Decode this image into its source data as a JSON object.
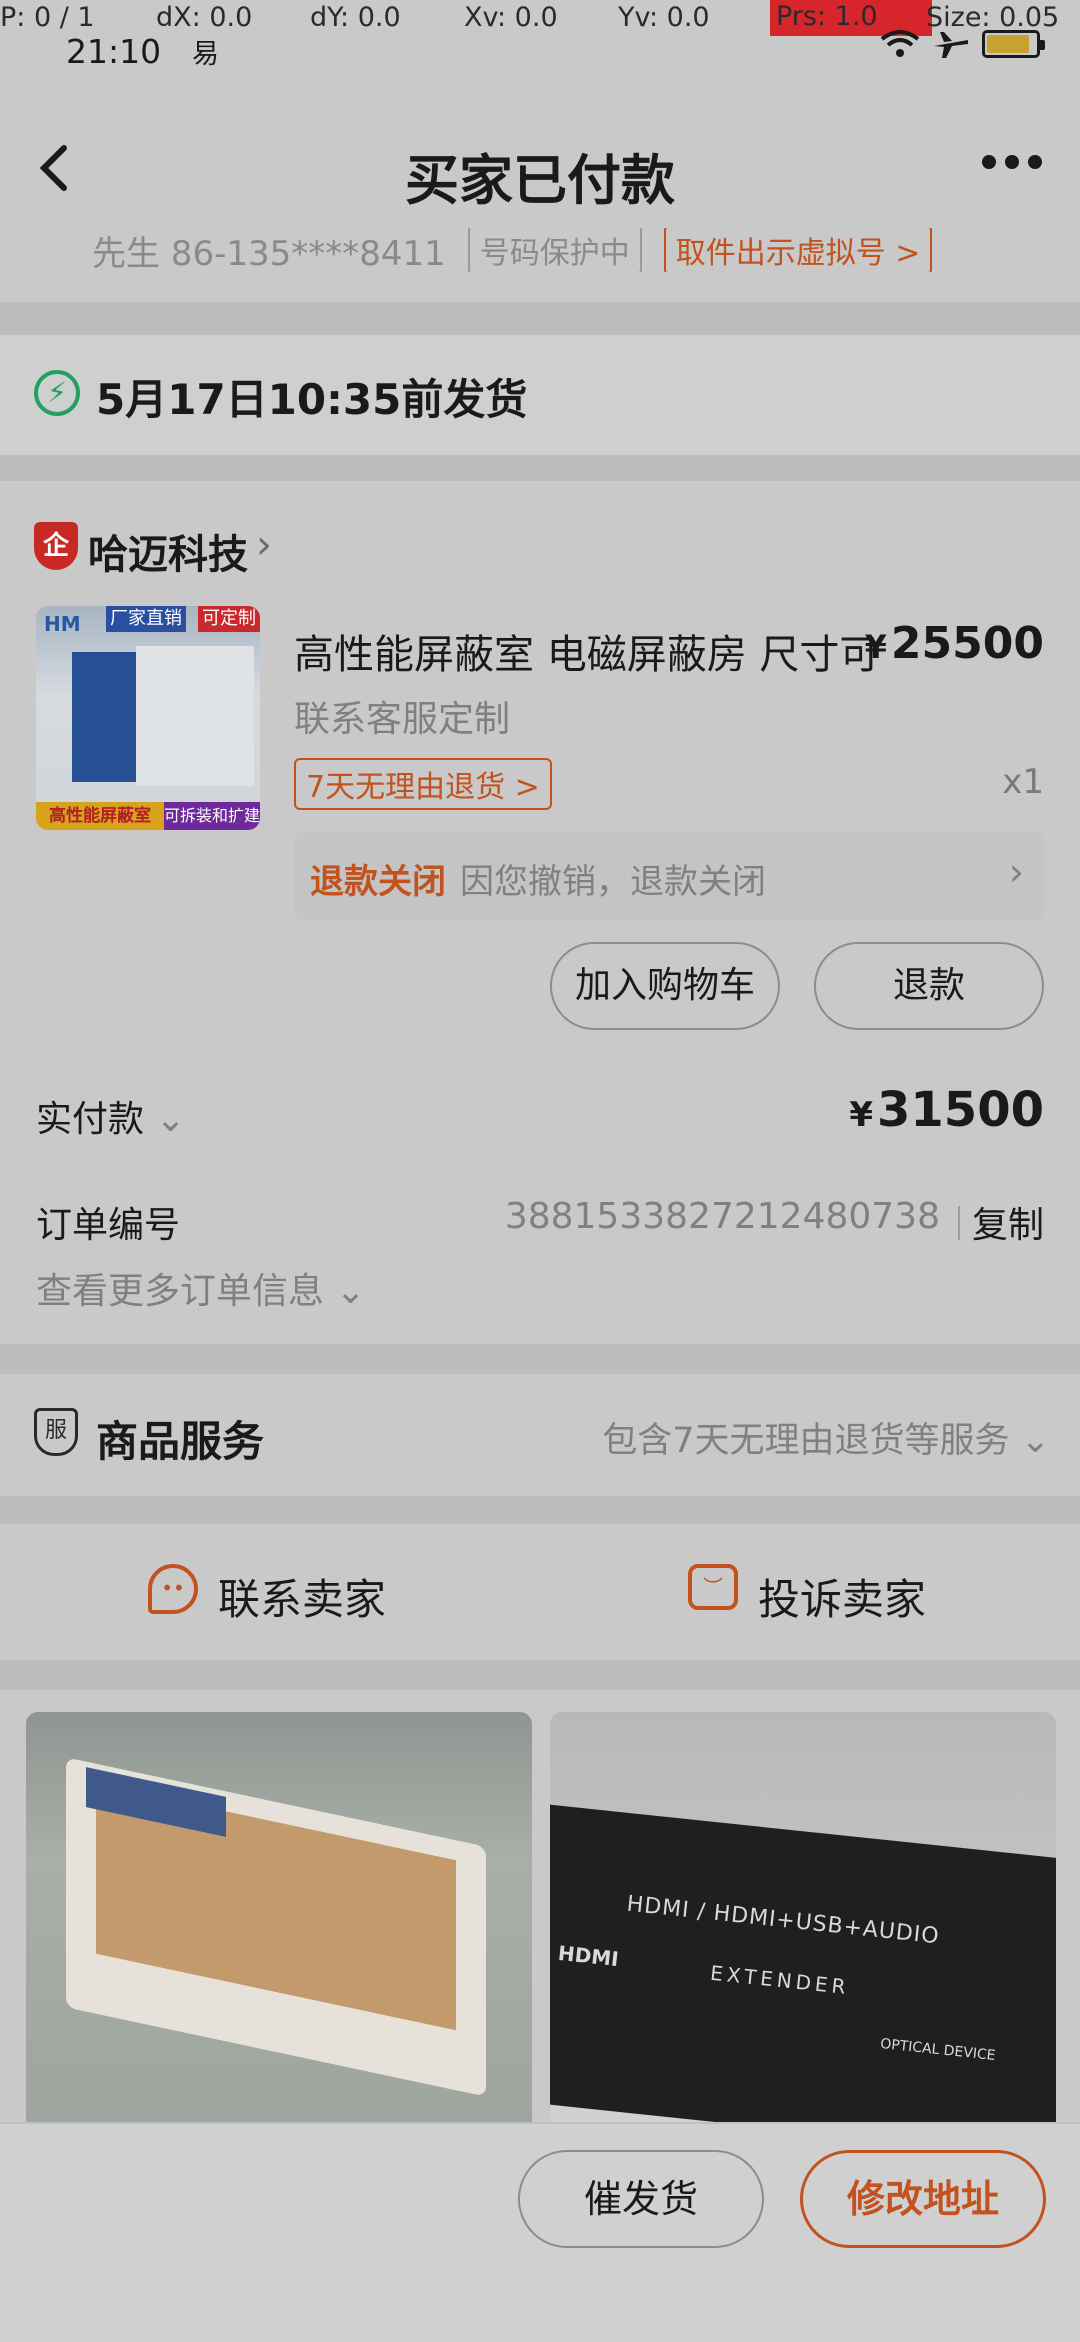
{
  "debug": {
    "p": "P: 0 / 1",
    "dx": "dX: 0.0",
    "dy": "dY: 0.0",
    "xv": "Xv: 0.0",
    "yv": "Yv: 0.0",
    "prs": "Prs: 1.0",
    "size": "Size: 0.05"
  },
  "status_bar": {
    "time": "21:10",
    "app_glyph": "易"
  },
  "header": {
    "title": "买家已付款",
    "back_icon": "‹"
  },
  "address": {
    "contact": "先生 86-135****8411",
    "privacy_tag": "号码保护中",
    "virtual_tag": "取件出示虚拟号 >"
  },
  "shipping": {
    "deadline": "5月17日10:35前发货"
  },
  "shop": {
    "badge": "企",
    "name": "哈迈科技"
  },
  "product": {
    "title": "高性能屏蔽室 电磁屏蔽房 尺寸可",
    "currency": "¥",
    "price": "25500",
    "subtitle": "联系客服定制",
    "return_tag": "7天无理由退货 >",
    "qty": "x1",
    "thumb": {
      "logo": "HM",
      "badge_left": "厂家直销",
      "badge_right": "可定制",
      "footer_left": "高性能屏蔽室",
      "footer_right": "可拆装和扩建"
    }
  },
  "refund_status": {
    "label": "退款关闭",
    "text": "因您撤销，退款关闭"
  },
  "actions": {
    "add_cart": "加入购物车",
    "refund": "退款"
  },
  "payment": {
    "label": "实付款",
    "currency": "¥",
    "amount": "31500"
  },
  "order": {
    "label": "订单编号",
    "number": "3881533827212480738",
    "copy": "复制",
    "more_info": "查看更多订单信息"
  },
  "service": {
    "icon_text": "服",
    "title": "商品服务",
    "detail": "包含7天无理由退货等服务"
  },
  "contact": {
    "seller": "联系卖家",
    "complain": "投诉卖家"
  },
  "recommend": {
    "device_line1": "HDMI / HDMI+USB+AUDIO",
    "device_brand": "HDMI",
    "device_line2": "EXTENDER",
    "device_line3": "OPTICAL DEVICE"
  },
  "bottom_bar": {
    "urge_shipping": "催发货",
    "edit_address": "修改地址"
  },
  "colors": {
    "accent": "#c2531f",
    "green": "#23a05f",
    "overlay_bg": "#c9c9c9"
  }
}
